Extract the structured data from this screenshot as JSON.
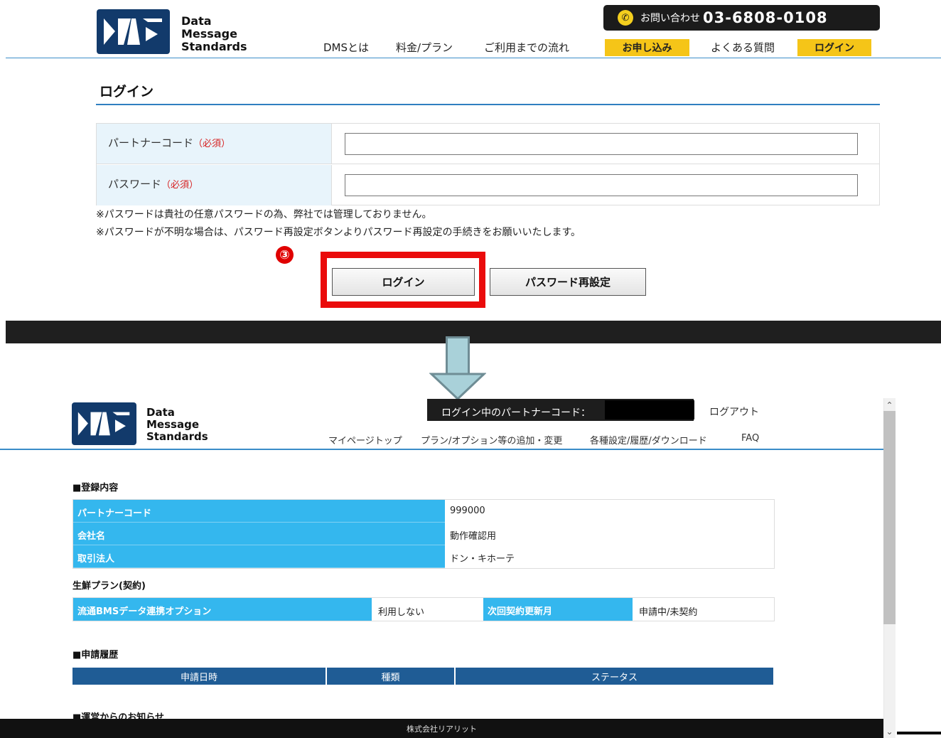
{
  "top": {
    "logo": {
      "line1": "Data",
      "line2": "Message",
      "line3": "Standards"
    },
    "contact": {
      "label": "お問い合わせ",
      "phone": "03-6808-0108"
    },
    "nav": {
      "about": "DMSとは",
      "pricing": "料金/プラン",
      "flow": "ご利用までの流れ",
      "apply": "お申し込み",
      "faq": "よくある質問",
      "login": "ログイン"
    },
    "page_title": "ログイン",
    "form": {
      "partner_code_label": "パートナーコード",
      "password_label": "パスワード",
      "required": "（必須）",
      "partner_code_value": "",
      "password_value": ""
    },
    "notes": [
      "※パスワードは貴社の任意パスワードの為、弊社では管理しておりません。",
      "※パスワードが不明な場合は、パスワード再設定ボタンよりパスワード再設定の手続きをお願いいたします。"
    ],
    "step_marker": "③",
    "buttons": {
      "login": "ログイン",
      "reset_password": "パスワード再設定"
    }
  },
  "bottom": {
    "logo": {
      "line1": "Data",
      "line2": "Message",
      "line3": "Standards"
    },
    "status_label": "ログイン中のパートナーコード：",
    "logout": "ログアウト",
    "nav": {
      "mypage": "マイページトップ",
      "plans": "プラン/オプション等の追加・変更",
      "settings": "各種設定/履歴/ダウンロード",
      "faq": "FAQ"
    },
    "registration": {
      "heading": "■登録内容",
      "rows": [
        {
          "label": "パートナーコード",
          "value": "999000"
        },
        {
          "label": "会社名",
          "value": "動作確認用"
        },
        {
          "label": "取引法人",
          "value": "ドン・キホーテ"
        }
      ]
    },
    "plan": {
      "heading": "生鮮プラン(契約)",
      "option_label": "流通BMSデータ連携オプション",
      "option_value": "利用しない",
      "renewal_label": "次回契約更新月",
      "renewal_value": "申請中/未契約"
    },
    "history": {
      "heading": "■申請履歴",
      "columns": [
        "申請日時",
        "種類",
        "ステータス"
      ]
    },
    "notice_heading": "■運営からのお知らせ",
    "footer": "株式会社リアリット"
  },
  "colors": {
    "accent_yellow": "#f5c518",
    "brand_navy": "#123a6b",
    "table_blue": "#34b7ee",
    "history_header": "#1f5c95",
    "highlight_red": "#ea0b0b"
  }
}
